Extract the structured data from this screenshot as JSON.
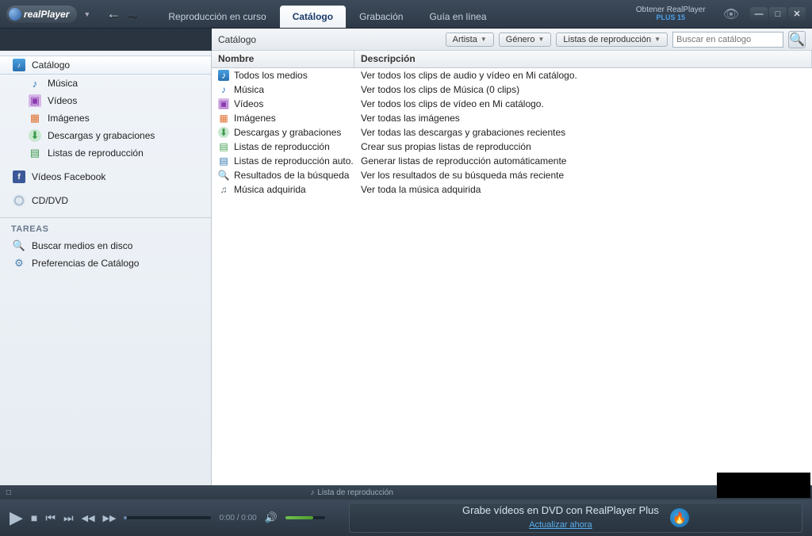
{
  "header": {
    "app_name": "realPlayer",
    "tabs": [
      {
        "label": "Reproducción en curso"
      },
      {
        "label": "Catálogo"
      },
      {
        "label": "Grabación"
      },
      {
        "label": "Guía en línea"
      }
    ],
    "upgrade_line1": "Obtener RealPlayer",
    "upgrade_line2": "PLUS 15"
  },
  "toolbar": {
    "breadcrumb": "Catálogo",
    "filters": [
      {
        "label": "Artista"
      },
      {
        "label": "Género"
      },
      {
        "label": "Listas de reproducción"
      }
    ],
    "search_placeholder": "Buscar en catálogo"
  },
  "sidebar": {
    "items": [
      {
        "label": "Catálogo",
        "icon": "catalog-icon",
        "selected": true
      },
      {
        "label": "Música",
        "icon": "music-icon",
        "child": true
      },
      {
        "label": "Vídeos",
        "icon": "video-icon",
        "child": true
      },
      {
        "label": "Imágenes",
        "icon": "image-icon",
        "child": true
      },
      {
        "label": "Descargas y grabaciones",
        "icon": "download-icon",
        "child": true
      },
      {
        "label": "Listas de reproducción",
        "icon": "playlist-icon",
        "child": true
      },
      {
        "label": "Vídeos Facebook",
        "icon": "facebook-icon",
        "section": true
      },
      {
        "label": "CD/DVD",
        "icon": "disc-icon",
        "section": true
      }
    ],
    "tasks_header": "TAREAS",
    "tasks": [
      {
        "label": "Buscar medios en disco",
        "icon": "search-disk-icon"
      },
      {
        "label": "Preferencias de Catálogo",
        "icon": "preferences-icon"
      }
    ]
  },
  "table": {
    "columns": {
      "name": "Nombre",
      "desc": "Descripción"
    },
    "rows": [
      {
        "icon": "all-media-icon",
        "name": "Todos los medios",
        "desc": "Ver todos los clips de audio y vídeo en Mi catálogo."
      },
      {
        "icon": "music-icon",
        "name": "Música",
        "desc": "Ver todos los clips de Música (0 clips)"
      },
      {
        "icon": "video-icon",
        "name": "Vídeos",
        "desc": "Ver todos los clips de vídeo en Mi catálogo."
      },
      {
        "icon": "image-icon",
        "name": "Imágenes",
        "desc": "Ver todas las imágenes"
      },
      {
        "icon": "download-icon",
        "name": "Descargas y grabaciones",
        "desc": "Ver todas las descargas y grabaciones recientes"
      },
      {
        "icon": "playlist-icon",
        "name": "Listas de reproducción",
        "desc": "Crear sus propias listas de reproducción"
      },
      {
        "icon": "autoplaylist-icon",
        "name": "Listas de reproducción auto...",
        "desc": "Generar listas de reproducción automáticamente"
      },
      {
        "icon": "search-results-icon",
        "name": "Resultados de la búsqueda",
        "desc": "Ver los resultados de su búsqueda más reciente"
      },
      {
        "icon": "purchased-icon",
        "name": "Música adquirida",
        "desc": "Ver toda la música adquirida"
      }
    ]
  },
  "statusbar": {
    "playlist_label": "Lista de reproducción"
  },
  "player": {
    "time": "0:00 / 0:00"
  },
  "promo": {
    "title": "Grabe vídeos en DVD con RealPlayer Plus",
    "link": "Actualizar ahora"
  }
}
